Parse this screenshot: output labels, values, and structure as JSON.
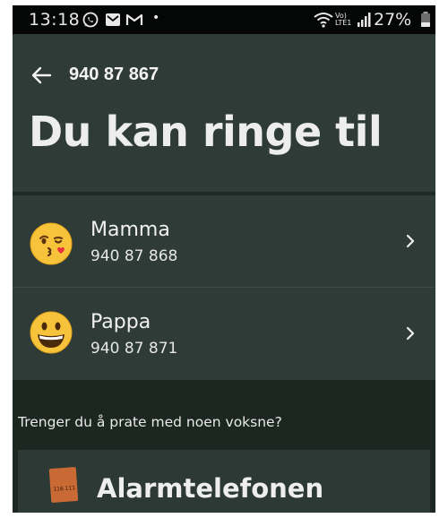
{
  "status_bar": {
    "time": "13:18",
    "icons_left": [
      "whatsapp-icon",
      "mail-icon",
      "gmail-icon"
    ],
    "dot": "•",
    "icons_right": [
      "wifi-icon",
      "volte-icon",
      "signal-icon"
    ],
    "volte_label_top": "Vo)",
    "volte_label_bottom": "LTE1",
    "battery": "27%"
  },
  "header": {
    "phone_number": "940 87 867",
    "title": "Du kan ringe til"
  },
  "contacts": [
    {
      "name": "Mamma",
      "number": "940 87 868",
      "emoji": "face-blowing-kiss-icon"
    },
    {
      "name": "Pappa",
      "number": "940 87 871",
      "emoji": "grinning-face-icon"
    }
  ],
  "help": {
    "question": "Trenger du å prate med noen voksne?",
    "alarm_title": "Alarmtelefonen",
    "alarm_logo_text": "116 111"
  },
  "colors": {
    "header_bg": "#2e3b36",
    "screen_bg": "#1f2a24",
    "lower_bg": "#1b2720",
    "logo": "#c96a35"
  }
}
